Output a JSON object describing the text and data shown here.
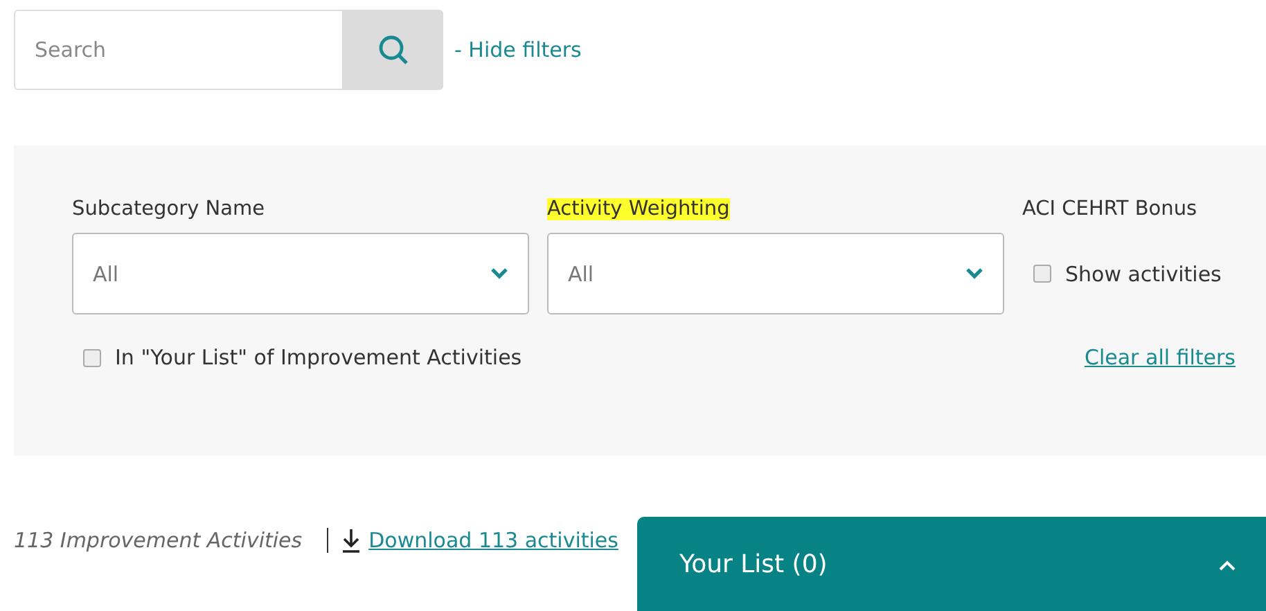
{
  "search": {
    "placeholder": "Search"
  },
  "hide_filters_link": "- Hide filters",
  "filters": [
    {
      "kind": "select",
      "label": "Subcategory Name",
      "highlighted": false,
      "value": "All"
    },
    {
      "kind": "select",
      "label": "Activity Weighting",
      "highlighted": true,
      "value": "All"
    },
    {
      "kind": "checkbox",
      "label": "ACI CEHRT Bonus",
      "highlighted": false,
      "option": "Show activities",
      "checked": false
    }
  ],
  "your_list_filter": {
    "label": "In \"Your List\" of Improvement Activities",
    "checked": false
  },
  "clear_filters_link": "Clear all filters",
  "result_count": "113 Improvement Activities",
  "download_link": "Download 113 activities",
  "your_list_panel": {
    "title": "Your List (0)",
    "expanded": false
  }
}
